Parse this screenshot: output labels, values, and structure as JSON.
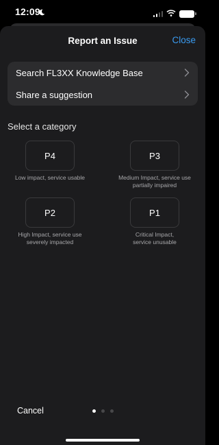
{
  "status": {
    "time": "12:09"
  },
  "header": {
    "title": "Report an Issue",
    "close_label": "Close"
  },
  "menu": {
    "items": [
      {
        "label": "Search FL3XX Knowledge Base"
      },
      {
        "label": "Share a suggestion"
      }
    ]
  },
  "section_label": "Select a category",
  "categories": [
    {
      "code": "P4",
      "desc_line1": "Low impact, service usable",
      "desc_line2": ""
    },
    {
      "code": "P3",
      "desc_line1": "Medium Impact, service use",
      "desc_line2": "partially impaired"
    },
    {
      "code": "P2",
      "desc_line1": "High Impact, service use",
      "desc_line2": "severely impacted"
    },
    {
      "code": "P1",
      "desc_line1": "Critical Impact,",
      "desc_line2": "service unusable"
    }
  ],
  "footer": {
    "cancel_label": "Cancel",
    "page_count": 3,
    "active_page": 1
  },
  "colors": {
    "accent": "#3a9bf0",
    "sheet_bg": "#1c1c1e",
    "card_bg": "#2c2c2e"
  }
}
